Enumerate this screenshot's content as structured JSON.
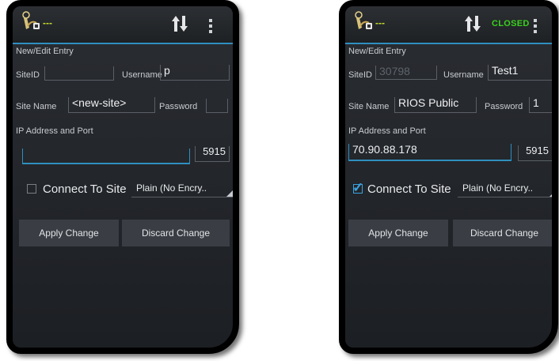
{
  "left": {
    "status_text": "---",
    "section_title": "New/Edit Entry",
    "siteid_label": "SiteID",
    "siteid_value": "",
    "username_label": "Username",
    "username_value": "p",
    "sitename_label": "Site Name",
    "sitename_value": "<new-site>",
    "password_label": "Password",
    "password_value": "",
    "ip_label": "IP Address and Port",
    "ip_value": "",
    "port_value": "5915",
    "connect_label": "Connect To Site",
    "connect_checked": false,
    "encryption_value": "Plain (No Encry..",
    "apply_label": "Apply Change",
    "discard_label": "Discard Change"
  },
  "right": {
    "status_text": "---",
    "connection_status": "CLOSED",
    "section_title": "New/Edit Entry",
    "siteid_label": "SiteID",
    "siteid_placeholder": "30798",
    "username_label": "Username",
    "username_value": "Test1",
    "sitename_label": "Site Name",
    "sitename_value": "RIOS Public",
    "password_label": "Password",
    "password_value": "1",
    "ip_label": "IP Address and Port",
    "ip_value": "70.90.88.178",
    "port_value": "5915",
    "connect_label": "Connect To Site",
    "connect_checked": true,
    "encryption_value": "Plain (No Encry..",
    "apply_label": "Apply Change",
    "discard_label": "Discard Change"
  },
  "colors": {
    "accent": "#2f8fbf",
    "closed_green": "#39d11d",
    "status_yellow": "#c8e02c"
  }
}
